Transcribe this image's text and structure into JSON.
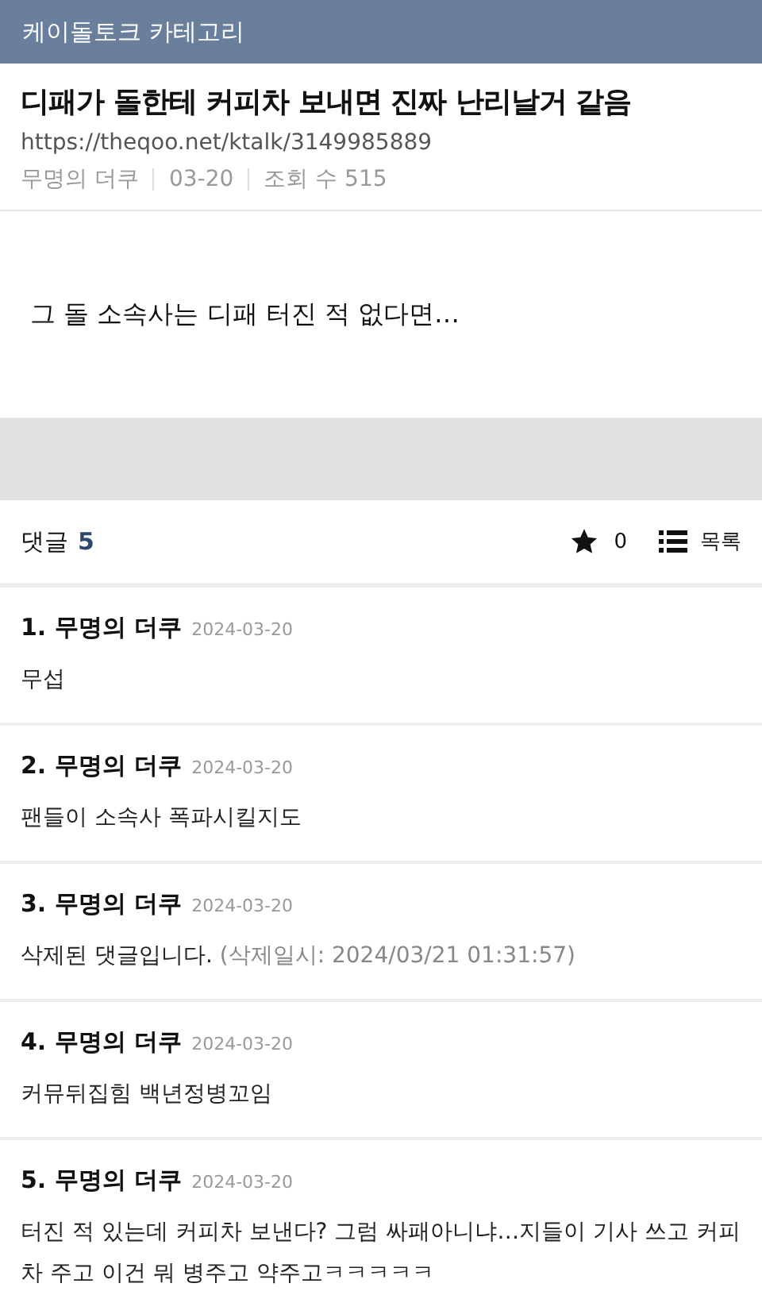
{
  "header": {
    "title": "케이돌토크 카테고리"
  },
  "post": {
    "title": "디패가 돌한테 커피차 보내면 진짜 난리날거 같음",
    "url": "https://theqoo.net/ktalk/3149985889",
    "meta": [
      "무명의 더쿠",
      "03-20",
      "조회 수 515"
    ],
    "body": "그 돌 소속사는 디패 터진 적 없다면…"
  },
  "comments_bar": {
    "label": "댓글",
    "count": "5",
    "stars_count": "0",
    "list_label": "목록"
  },
  "comments": [
    {
      "kind": "normal",
      "author": "1. 무명의 더쿠",
      "date": "2024-03-20",
      "text": "무섭"
    },
    {
      "kind": "normal",
      "author": "2. 무명의 더쿠",
      "date": "2024-03-20",
      "text": "팬들이 소속사 폭파시킬지도"
    },
    {
      "kind": "deleted",
      "author": "3. 무명의 더쿠",
      "date": "2024-03-20",
      "text": "삭제된 댓글입니다.",
      "note": "(삭제일시: 2024/03/21 01:31:57)"
    },
    {
      "kind": "normal",
      "author": "4. 무명의 더쿠",
      "date": "2024-03-20",
      "text": "커뮤뒤집힘 백년정병꼬임"
    },
    {
      "kind": "normal",
      "author": "5. 무명의 더쿠",
      "date": "2024-03-20",
      "text": "터진 적 있는데 커피차 보낸다? 그럼 싸패아니냐…지들이 기사 쓰고 커피차 주고 이건 뭐 병주고 약주고ㅋㅋㅋㅋㅋ"
    }
  ]
}
